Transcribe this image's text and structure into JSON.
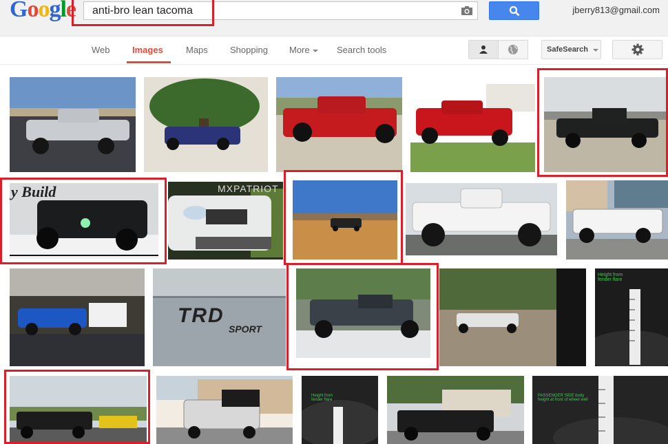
{
  "brand": {
    "logo_text": "Google",
    "accent": "#dd4b39",
    "highlight_color": "#d9202a"
  },
  "search": {
    "query": "anti-bro lean tacoma",
    "camera_icon": "camera-icon",
    "button_icon": "search-icon"
  },
  "account": {
    "email": "jberry813@gmail.com"
  },
  "nav": {
    "tabs": [
      {
        "label": "Web",
        "active": false
      },
      {
        "label": "Images",
        "active": true
      },
      {
        "label": "Maps",
        "active": false
      },
      {
        "label": "Shopping",
        "active": false
      },
      {
        "label": "More",
        "active": false
      },
      {
        "label": "Search tools",
        "active": false
      }
    ],
    "safesearch_label": "SafeSearch",
    "person_icon": "person-icon",
    "globe_icon": "globe-icon",
    "settings_icon": "gear-icon"
  },
  "results": {
    "overlays": {
      "snow_build": "y Build",
      "mxpatriot": "MXPATRIOT",
      "trd_logo": "TRD",
      "trd_sub": "SPORT",
      "ruler_note_1": "Height from fender flare",
      "ruler_note_2": "PASSENGER SIDE body height at front of wheel well"
    }
  }
}
